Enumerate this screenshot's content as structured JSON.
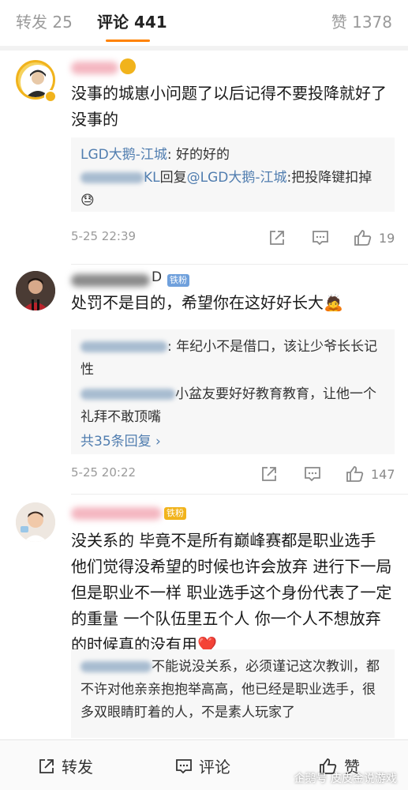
{
  "tabs": {
    "repost": "转发 25",
    "comment": "评论 441",
    "like": "赞 1378"
  },
  "comments": [
    {
      "text": "没事的城崽小问题了以后记得不要投降就好了没事的",
      "replies": [
        {
          "name": "LGD大鹅-江城",
          "content": ": 好的好的"
        },
        {
          "name_tail": "KL",
          "middle": "回复",
          "mention": "@LGD大鹅-江城",
          "content": ":把投降键扣掉😓"
        }
      ],
      "time": "5-25 22:39",
      "likes": "19"
    },
    {
      "name_tail": "D",
      "badge": "铁粉",
      "text": "处罚不是目的，希望你在这好好长大🙇",
      "replies": [
        {
          "content": ": 年纪小不是借口，该让少爷长长记性"
        },
        {
          "content": "小盆友要好好教育教育，让他一个礼拜不敢顶嘴"
        }
      ],
      "more": "共35条回复 ›",
      "time": "5-25 20:22",
      "likes": "147"
    },
    {
      "badge": "铁粉",
      "text": "没关系的 毕竟不是所有巅峰赛都是职业选手 他们觉得没希望的时候也许会放弃 进行下一局 但是职业不一样 职业选手这个身份代表了一定的重量 一个队伍里五个人 你一个人不想放弃的时候真的没有用❤️",
      "replies": [
        {
          "content": "不能说没关系，必须谨记这次教训，都不许对他亲亲抱抱举高高，他已经是职业选手，很多双眼睛盯着的人，不是素人玩家了"
        }
      ]
    }
  ],
  "bottom": {
    "repost": "转发",
    "comment": "评论",
    "like": "赞",
    "watermark": "企鹅号 皮皮金说游戏"
  },
  "colors": {
    "accent": "#ff8200",
    "link": "#507daf",
    "badge": "#6fa0dc"
  }
}
